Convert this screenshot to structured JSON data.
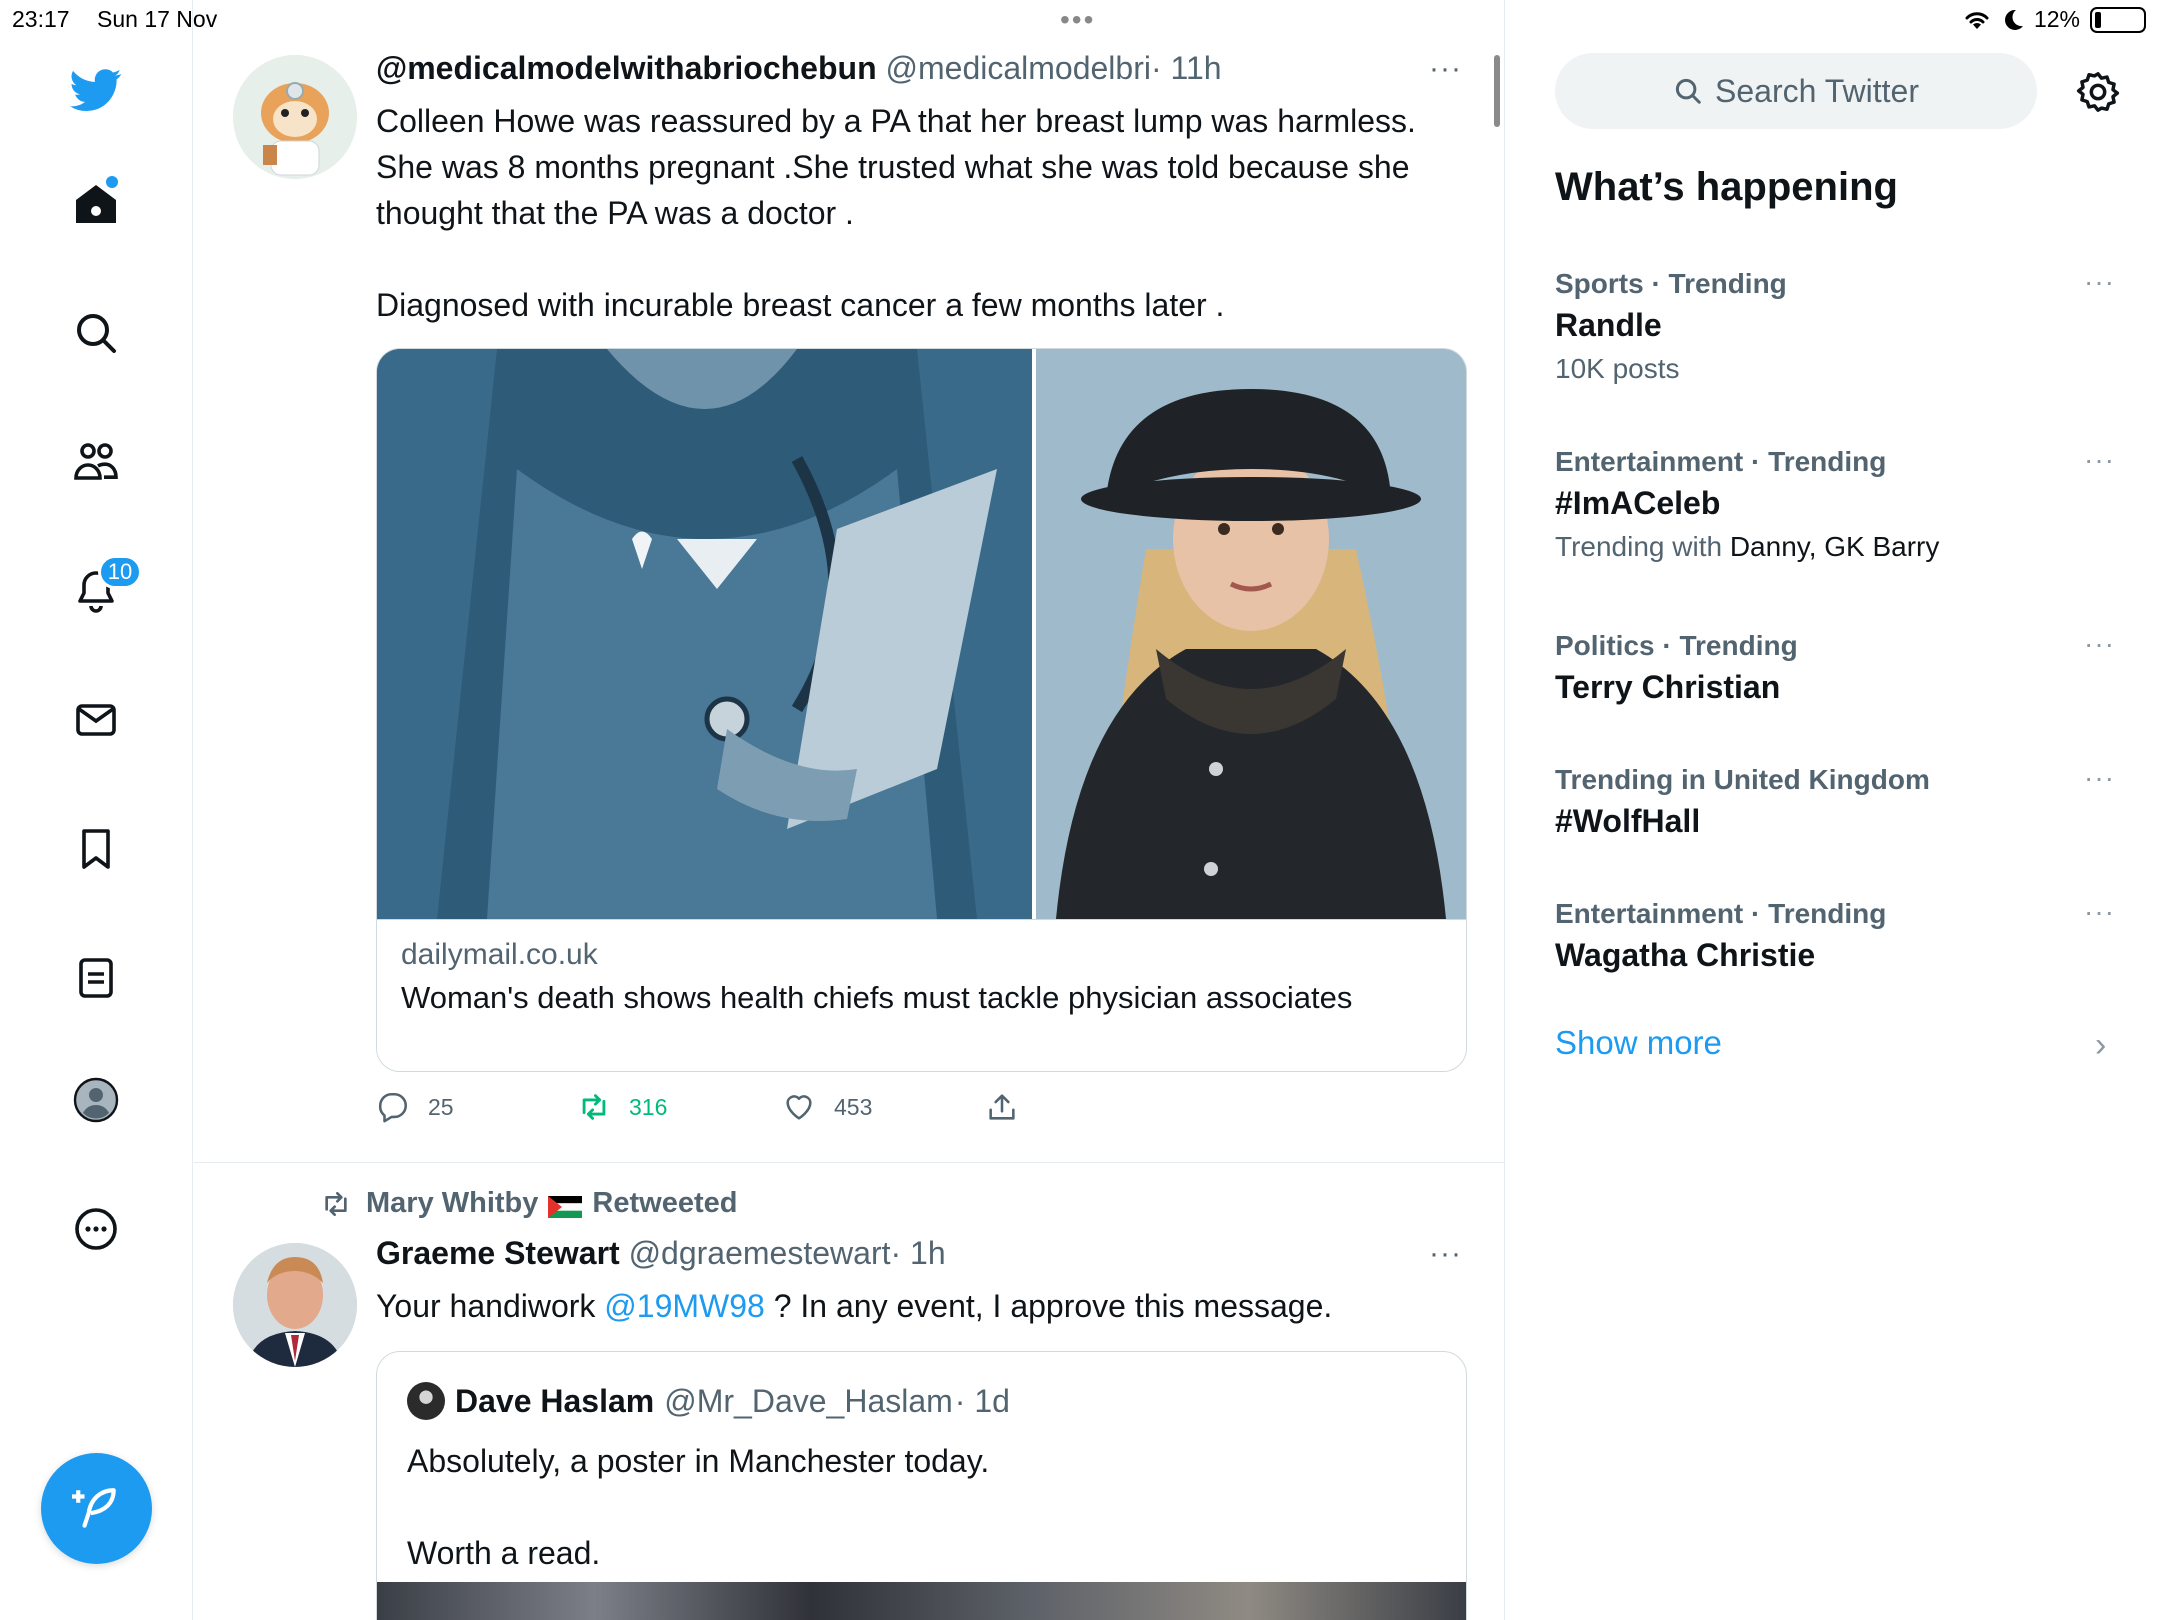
{
  "status_bar": {
    "time": "23:17",
    "date": "Sun 17 Nov",
    "battery": "12%",
    "battery_level": 0.12
  },
  "nav": {
    "icons": [
      "twitter-logo-icon",
      "home-icon",
      "search-icon",
      "communities-icon",
      "notifications-icon",
      "messages-icon",
      "bookmarks-icon",
      "lists-icon",
      "profile-icon",
      "more-icon"
    ],
    "notification_count": "10",
    "compose_icon": "compose-icon"
  },
  "tweets": [
    {
      "name": "@medicalmodelwithabriochebun",
      "handle": "@medicalmodelbri",
      "time": "· 11h",
      "more": "···",
      "text": "Colleen Howe was reassured by a PA that her breast lump was harmless. She was 8 months pregnant .She trusted what she was told because she thought that the PA was a doctor .\n\nDiagnosed with incurable breast cancer a few months later .",
      "card": {
        "domain": "dailymail.co.uk",
        "title": "Woman's death shows health chiefs must tackle physician associates"
      },
      "actions": {
        "replies": "25",
        "retweets": "316",
        "likes": "453"
      }
    },
    {
      "retweeted_by": "Mary Whitby",
      "retweeted_label": "Retweeted",
      "name": "Graeme Stewart",
      "handle": "@dgraemestewart",
      "time": "· 1h",
      "more": "···",
      "text_before": "Your handiwork ",
      "mention": "@19MW98",
      "text_after": " ? In any event, I approve this message.",
      "quote": {
        "name": "Dave Haslam",
        "handle": "@Mr_Dave_Haslam",
        "time": "· 1d",
        "text": "Absolutely, a poster in Manchester today.\n\nWorth a read."
      }
    }
  ],
  "sidebar": {
    "search_placeholder": "Search Twitter",
    "title": "What’s happening",
    "trends": [
      {
        "meta": "Sports · Trending",
        "name": "Randle",
        "sub": "10K posts",
        "with": ""
      },
      {
        "meta": "Entertainment · Trending",
        "name": "#ImACeleb",
        "sub": "Trending with ",
        "with": "Danny, GK Barry"
      },
      {
        "meta": "Politics · Trending",
        "name": "Terry Christian",
        "sub": "",
        "with": ""
      },
      {
        "meta": "Trending in United Kingdom",
        "name": "#WolfHall",
        "sub": "",
        "with": ""
      },
      {
        "meta": "Entertainment · Trending",
        "name": "Wagatha Christie",
        "sub": "",
        "with": ""
      }
    ],
    "trend_more": "···",
    "show_more": "Show more",
    "show_more_chevron": "›"
  },
  "colors": {
    "accent": "#1d9bf0",
    "retweet_green": "#00ba7c",
    "secondary_text": "#536471"
  }
}
